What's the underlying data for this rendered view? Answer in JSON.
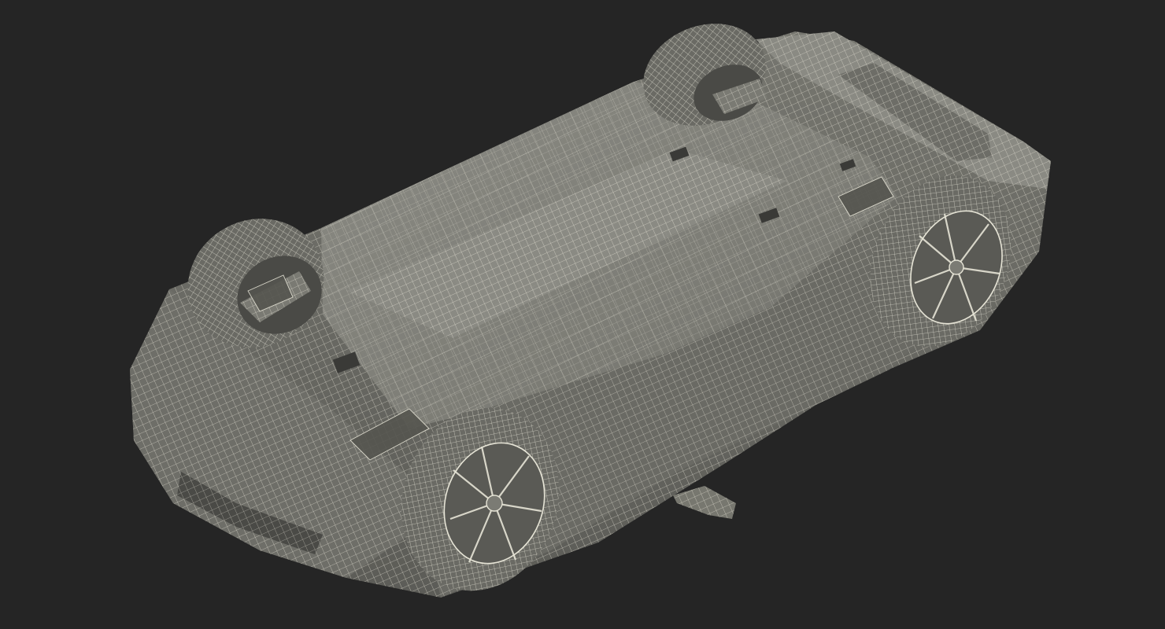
{
  "scene": {
    "subject": "car-underside-wireframe-render",
    "colors": {
      "background": "#252525",
      "shade_dark": "#5f5f59",
      "shade_mid": "#7b7b74",
      "shade_light": "#8e8e86",
      "wire": "#e6e4d6"
    }
  }
}
